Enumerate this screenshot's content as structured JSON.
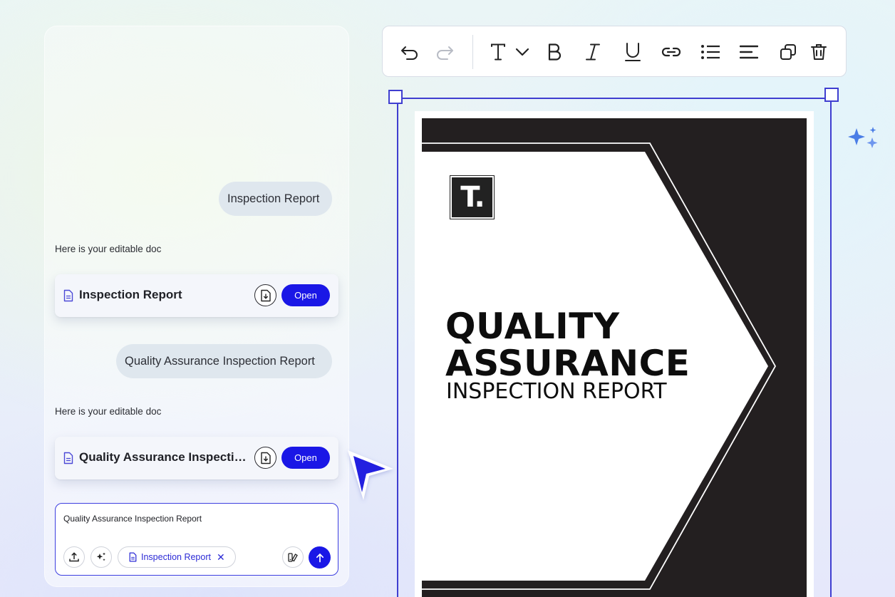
{
  "chat": {
    "messages": [
      {
        "role": "user",
        "text": "Inspection Report"
      },
      {
        "role": "assistant",
        "text": "Here is your editable doc",
        "doc_title": "Inspection Report",
        "open_label": "Open"
      },
      {
        "role": "user",
        "text": "Quality Assurance Inspection Report"
      },
      {
        "role": "assistant",
        "text": "Here is your editable doc",
        "doc_title": "Quality Assurance Inspectio...",
        "open_label": "Open"
      }
    ],
    "composer": {
      "value": "Quality Assurance Inspection Report",
      "chip_label": "Inspection Report",
      "chip_close": "✕"
    }
  },
  "toolbar": {
    "items": [
      "undo-icon",
      "redo-icon",
      "text-style-icon",
      "chevron-down-icon",
      "bold-icon",
      "italic-icon",
      "underline-icon",
      "link-icon",
      "bulleted-list-icon",
      "align-left-icon",
      "duplicate-icon",
      "delete-icon"
    ]
  },
  "document": {
    "logo_text": "T.",
    "heading_line1": "QUALITY",
    "heading_line2": "ASSURANCE",
    "subheading": "INSPECTION REPORT"
  },
  "colors": {
    "accent": "#1a17e6",
    "selection": "#3f3ed0",
    "cover_dark": "#231f20"
  }
}
